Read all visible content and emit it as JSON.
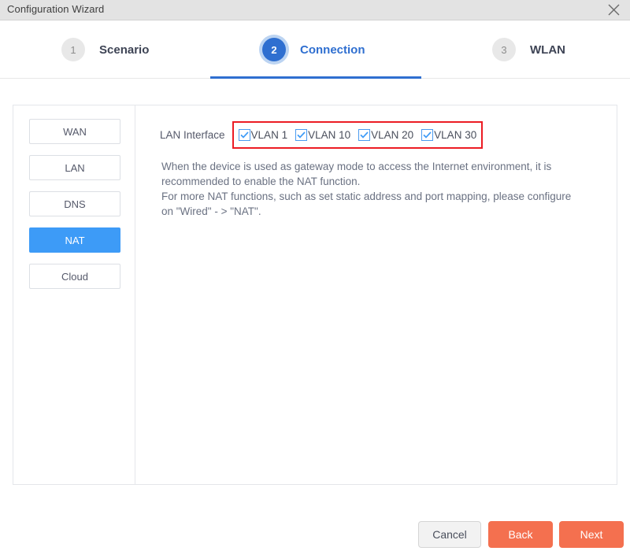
{
  "window": {
    "title": "Configuration Wizard",
    "close_icon": "close-icon"
  },
  "stepper": {
    "steps": [
      {
        "number": "1",
        "label": "Scenario",
        "active": false
      },
      {
        "number": "2",
        "label": "Connection",
        "active": true
      },
      {
        "number": "3",
        "label": "WLAN",
        "active": false
      }
    ],
    "active_color": "#2f6fd0",
    "inactive_badge_color": "#e8e8e8"
  },
  "sidebar": {
    "items": [
      {
        "label": "WAN",
        "selected": false
      },
      {
        "label": "LAN",
        "selected": false
      },
      {
        "label": "DNS",
        "selected": false
      },
      {
        "label": "NAT",
        "selected": true
      },
      {
        "label": "Cloud",
        "selected": false
      }
    ],
    "selected_color": "#3d9bf7"
  },
  "content": {
    "lan_interface_label": "LAN Interface",
    "highlight_color": "#ec1c24",
    "vlans": [
      {
        "label": "VLAN 1",
        "checked": true
      },
      {
        "label": "VLAN 10",
        "checked": true
      },
      {
        "label": "VLAN 20",
        "checked": true
      },
      {
        "label": "VLAN 30",
        "checked": true
      }
    ],
    "description_line1": "When the device is used as gateway mode to access the Internet environment, it is",
    "description_line2": "recommended to enable the NAT function.",
    "description_line3": "For more NAT functions, such as set static address and port mapping, please configure",
    "description_line4": "on \"Wired\" - > \"NAT\"."
  },
  "footer": {
    "cancel_label": "Cancel",
    "back_label": "Back",
    "next_label": "Next",
    "primary_color": "#f4704f"
  }
}
